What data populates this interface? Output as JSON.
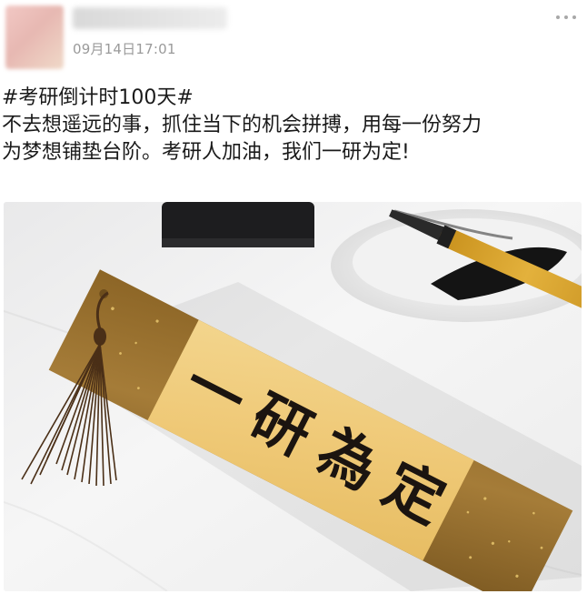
{
  "post": {
    "timestamp": "09月14日17:01",
    "hashtag": "#考研倒计时100天#",
    "body_line1": "不去想遥远的事，抓住当下的机会拼搏，用每一份努力",
    "body_line2": "为梦想铺垫台阶。考研人加油，我们一研为定!",
    "more_icon": "more-dots-icon"
  },
  "photo": {
    "bookmark_text": "一研為定"
  },
  "colors": {
    "text": "#1a1a1a",
    "timestamp": "#9a9a9a",
    "bookmark_gold": "#a07a36",
    "bookmark_center": "#f0ce82",
    "brush_handle": "#d9a62a"
  }
}
